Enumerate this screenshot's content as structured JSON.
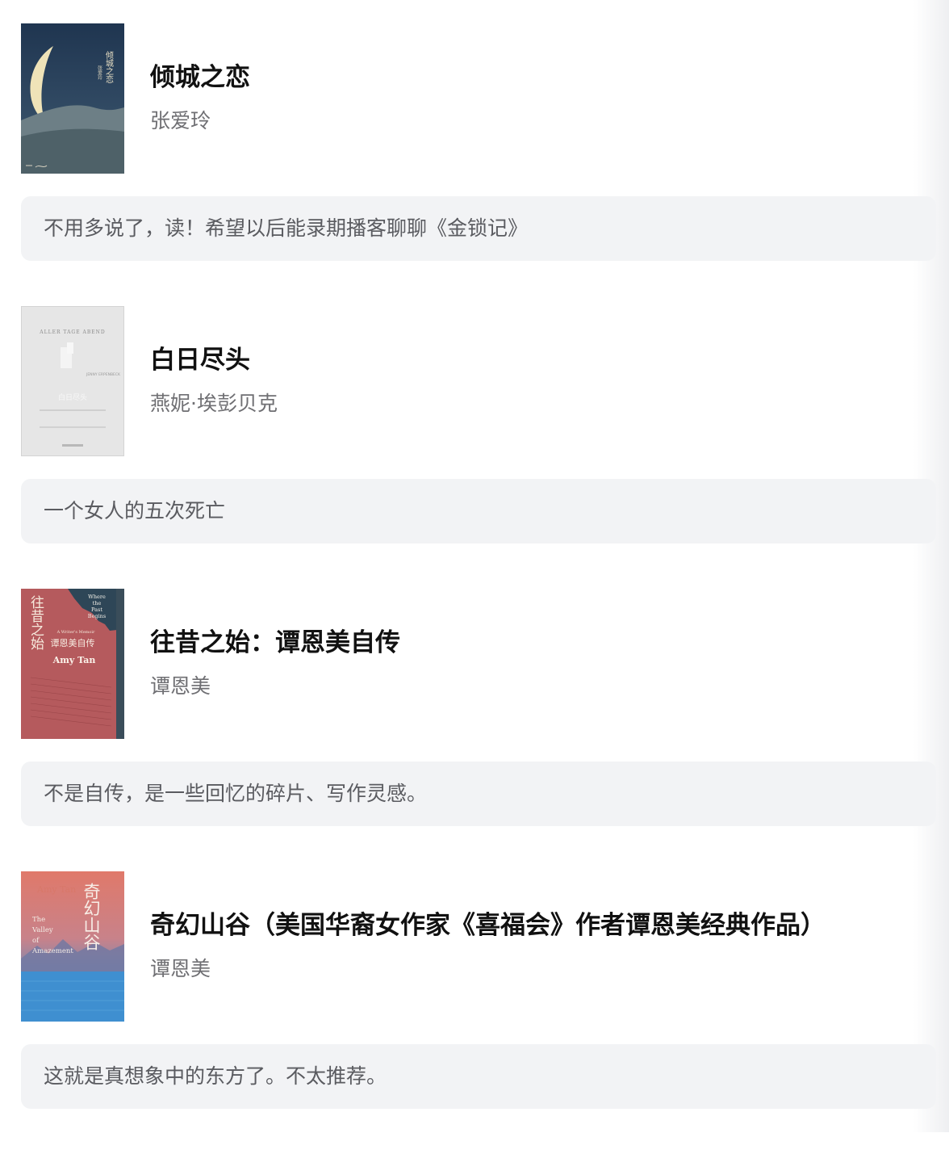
{
  "books": [
    {
      "title": "倾城之恋",
      "author": "张爱玲",
      "note": "不用多说了，读！希望以后能录期播客聊聊《金锁记》",
      "cover": {
        "texts": [
          "倾城之恋",
          "张爱玲"
        ]
      }
    },
    {
      "title": "白日尽头",
      "author": "燕妮·埃彭贝克",
      "note": "一个女人的五次死亡",
      "cover": {
        "texts": [
          "ALLER TAGE ABEND",
          "JENNY ERPENBECK",
          "白日尽头"
        ]
      }
    },
    {
      "title": "往昔之始：谭恩美自传",
      "author": "谭恩美",
      "note": "不是自传，是一些回忆的碎片、写作灵感。",
      "cover": {
        "texts": [
          "往昔之始",
          "Where",
          "the",
          "Past",
          "Begins",
          "A Writer's Memoir",
          "谭恩美自传",
          "Amy Tan"
        ]
      }
    },
    {
      "title": "奇幻山谷（美国华裔女作家《喜福会》作者谭恩美经典作品）",
      "author": "谭恩美",
      "note": "这就是真想象中的东方了。不太推荐。",
      "cover": {
        "texts": [
          "Amy Tan",
          "奇幻山谷",
          "The",
          "Valley",
          "of",
          "Amazement"
        ]
      }
    }
  ]
}
